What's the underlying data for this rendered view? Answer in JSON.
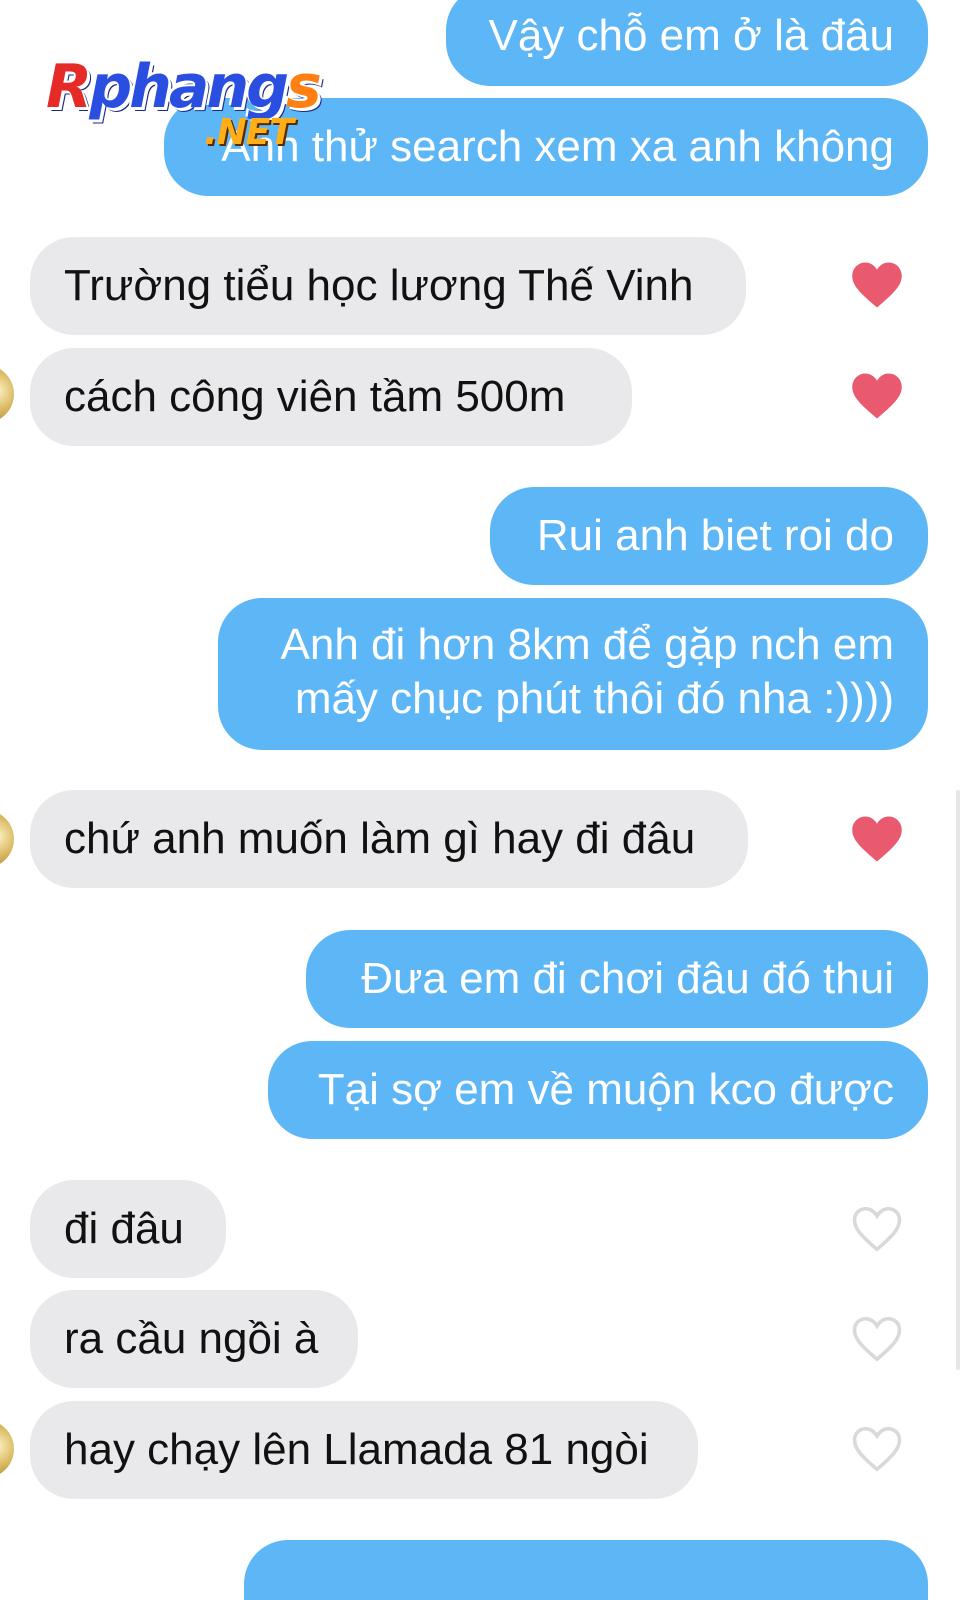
{
  "watermark": {
    "first_letter": "R",
    "middle": "phang",
    "last_letter": "s",
    "suffix": ".NET"
  },
  "messages": [
    {
      "direction": "outgoing",
      "lines": [
        "Vậy chỗ em ở là đâu"
      ]
    },
    {
      "direction": "outgoing",
      "lines": [
        "Anh thử search xem xa anh không"
      ]
    },
    {
      "direction": "incoming",
      "lines": [
        "Trường tiểu học lương Thế Vinh"
      ],
      "reaction": "liked"
    },
    {
      "direction": "incoming",
      "lines": [
        "cách công viên tầm 500m"
      ],
      "reaction": "liked"
    },
    {
      "direction": "outgoing",
      "lines": [
        "Rui anh biet roi do"
      ]
    },
    {
      "direction": "outgoing",
      "lines": [
        "Anh đi hơn 8km để gặp nch em",
        "mấy chục phút thôi đó nha :))))"
      ]
    },
    {
      "direction": "incoming",
      "lines": [
        "chứ anh muốn làm gì hay đi đâu"
      ],
      "reaction": "liked"
    },
    {
      "direction": "outgoing",
      "lines": [
        "Đưa em đi chơi đâu đó thui"
      ]
    },
    {
      "direction": "outgoing",
      "lines": [
        "Tại sợ em về muộn kco được"
      ]
    },
    {
      "direction": "incoming",
      "lines": [
        "đi đâu"
      ],
      "reaction": "not-liked"
    },
    {
      "direction": "incoming",
      "lines": [
        "ra cầu ngồi à"
      ],
      "reaction": "not-liked"
    },
    {
      "direction": "incoming",
      "lines": [
        "hay chạy lên Llamada 81 ngòi"
      ],
      "reaction": "not-liked"
    },
    {
      "direction": "outgoing",
      "lines": [
        ""
      ]
    }
  ],
  "colors": {
    "outgoing_bubble": "#5db6f5",
    "incoming_bubble": "#e9e9eb",
    "heart_liked": "#ea5a6f",
    "heart_outline": "#d9d9d9"
  },
  "icons": {
    "liked": "heart-filled-icon",
    "not_liked": "heart-outline-icon"
  }
}
